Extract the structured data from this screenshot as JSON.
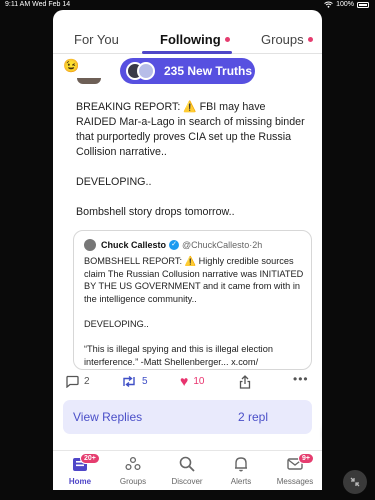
{
  "status_bar": {
    "time": "9:11 AM  Wed Feb 14",
    "battery": "100%"
  },
  "tabs": [
    {
      "label": "For You"
    },
    {
      "label": "Following"
    },
    {
      "label": "Groups"
    }
  ],
  "new_truths": {
    "label": "235 New Truths"
  },
  "post": {
    "body": "BREAKING REPORT: ⚠️  FBI may have RAIDED  Mar-a-Lago in search of missing binder that purportedly proves CIA set up the Russia Collision narrative..\n\nDEVELOPING..\n\nBombshell story drops tomorrow.."
  },
  "quote": {
    "author": "Chuck Callesto",
    "handle": "@ChuckCallesto",
    "time": "2h",
    "text": "BOMBSHELL REPORT:  ⚠️  Highly credible sources claim The Russian Collusion narrative was INITIATED BY THE US GOVERNMENT and it came from with in the intelligence community..\n\nDEVELOPING..\n\n“This is illegal spying and this is illegal election interference.” -Matt Shellenberger... x.com/"
  },
  "actions": {
    "replies": "2",
    "retruths": "5",
    "likes": "10"
  },
  "view_replies": {
    "label": "View Replies",
    "count": "2 repl"
  },
  "nav": [
    {
      "label": "Home",
      "badge": "20+"
    },
    {
      "label": "Groups"
    },
    {
      "label": "Discover"
    },
    {
      "label": "Alerts"
    },
    {
      "label": "Messages",
      "badge": "9+"
    }
  ],
  "colors": {
    "accent": "#5750e0",
    "pink": "#e9386a",
    "tab_accent": "#4f46c8"
  }
}
